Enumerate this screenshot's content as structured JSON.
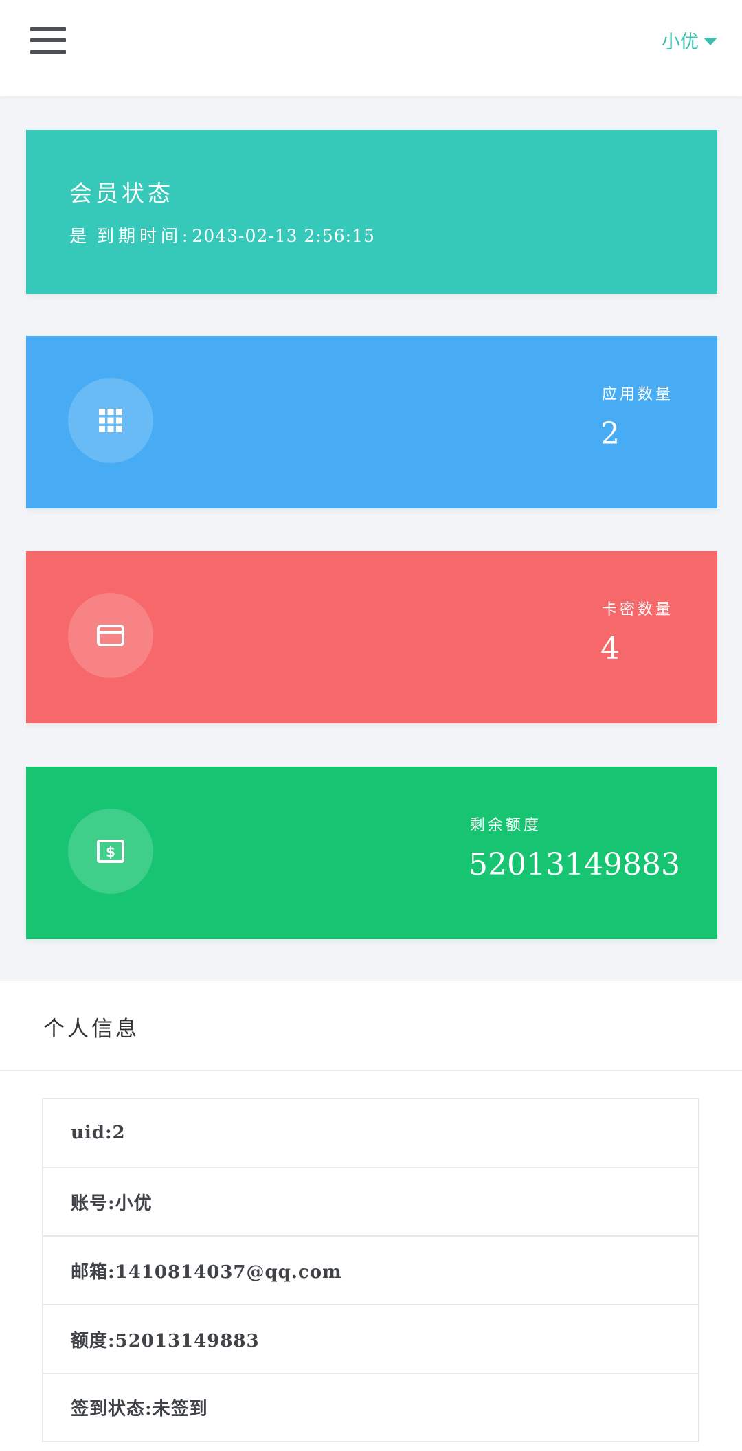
{
  "header": {
    "username": "小优",
    "colors": {
      "accent": "#3cbfae"
    }
  },
  "member_card": {
    "title": "会员状态",
    "status_word": "是",
    "expiry_label": "到期时间:",
    "expiry_time": "2043-02-13 2:56:15",
    "color": "#36c9b9"
  },
  "stats": {
    "apps": {
      "label": "应用数量",
      "value": "2",
      "icon": "apps-grid-icon",
      "color": "#48acf5"
    },
    "keys": {
      "label": "卡密数量",
      "value": "4",
      "icon": "credit-card-icon",
      "color": "#f7686b"
    },
    "quota": {
      "label": "剩余额度",
      "value": "52013149883",
      "icon": "money-icon",
      "color": "#17c472"
    }
  },
  "profile": {
    "title": "个人信息",
    "rows": [
      "uid:2",
      "账号:小优",
      "邮箱:1410814037@qq.com",
      "额度:52013149883",
      "签到状态:未签到"
    ]
  }
}
